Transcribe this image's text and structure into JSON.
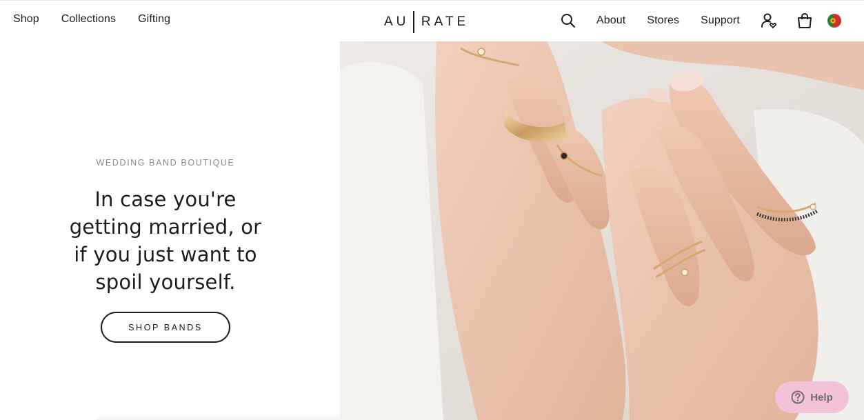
{
  "header": {
    "nav_left": [
      "Shop",
      "Collections",
      "Gifting"
    ],
    "logo_left": "AU",
    "logo_right": "RATE",
    "nav_right": [
      "About",
      "Stores",
      "Support"
    ],
    "icons": [
      "search-icon",
      "account-icon",
      "bag-icon",
      "portugal-flag-icon"
    ]
  },
  "hero": {
    "eyebrow": "WEDDING BAND BOUTIQUE",
    "headline": "In case you're getting married, or if you just want to spoil yourself.",
    "cta_label": "SHOP BANDS",
    "image_icon": "hands-with-gold-rings-photo"
  },
  "help": {
    "label": "Help",
    "icon": "question-circle-icon",
    "color": "#f3c1d8"
  }
}
